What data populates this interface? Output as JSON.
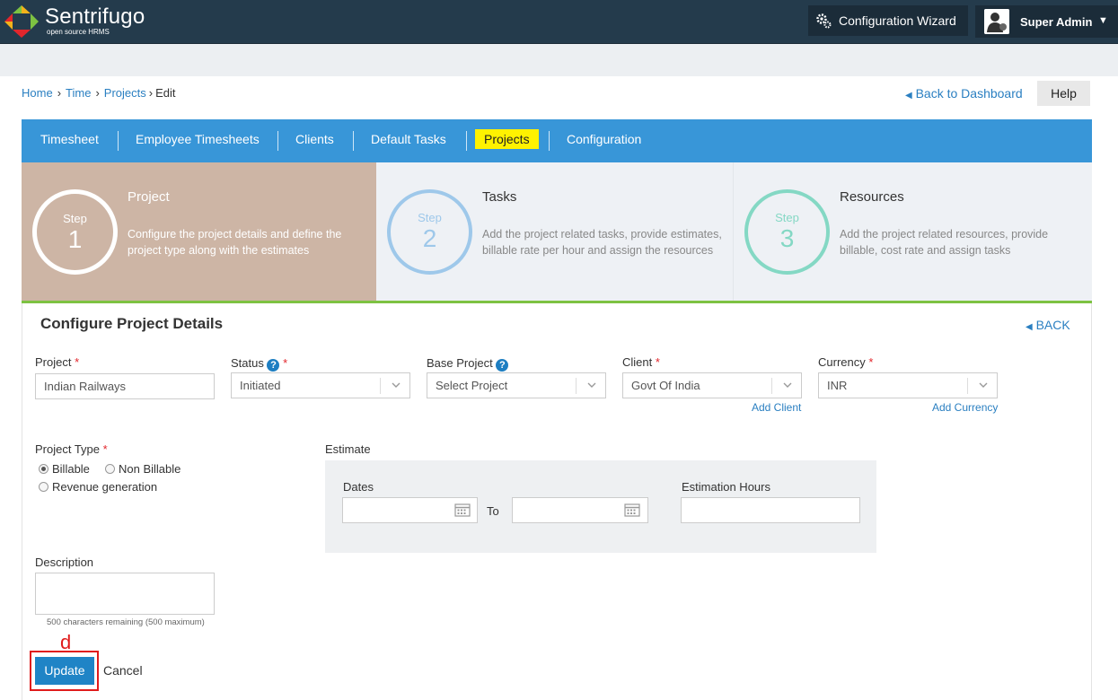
{
  "header": {
    "brand": "Sentrifugo",
    "tagline": "open source HRMS",
    "wizard_label": "Configuration Wizard",
    "user_name": "Super Admin"
  },
  "breadcrumb": {
    "home": "Home",
    "time": "Time",
    "projects": "Projects",
    "current": "Edit",
    "separator": "›"
  },
  "back_to_dashboard": "Back to Dashboard",
  "help_label": "Help",
  "nav": {
    "tabs": [
      "Timesheet",
      "Employee Timesheets",
      "Clients",
      "Default Tasks",
      "Projects",
      "Configuration"
    ],
    "active": "Projects",
    "active_color": "#fff200",
    "bar_color": "#3896d8"
  },
  "steps": [
    {
      "label": "Step",
      "number": "1",
      "title": "Project",
      "description": "Configure the project details and define the project type along with the estimates"
    },
    {
      "label": "Step",
      "number": "2",
      "title": "Tasks",
      "description": "Add the project related tasks, provide estimates, billable rate per hour and assign the resources"
    },
    {
      "label": "Step",
      "number": "3",
      "title": "Resources",
      "description": "Add the project related resources, provide billable, cost rate and assign tasks"
    }
  ],
  "form": {
    "title": "Configure Project Details",
    "back_label": "BACK",
    "project": {
      "label": "Project",
      "value": "Indian Railways"
    },
    "status": {
      "label": "Status",
      "value": "Initiated"
    },
    "base_project": {
      "label": "Base Project",
      "value": "Select Project"
    },
    "client": {
      "label": "Client",
      "value": "Govt Of India",
      "add_label": "Add Client"
    },
    "currency": {
      "label": "Currency",
      "value": "INR",
      "add_label": "Add Currency"
    },
    "project_type": {
      "label": "Project Type",
      "options": [
        "Billable",
        "Non Billable",
        "Revenue generation"
      ],
      "selected": "Billable"
    },
    "estimate": {
      "label": "Estimate",
      "dates_label": "Dates",
      "to_label": "To",
      "hours_label": "Estimation Hours"
    },
    "description": {
      "label": "Description",
      "remaining": "500 characters remaining (500 maximum)"
    },
    "required_mark": "*",
    "help_mark": "?",
    "update_label": "Update",
    "cancel_label": "Cancel"
  },
  "annotation": {
    "label": "d",
    "color": "#e01b1b"
  }
}
